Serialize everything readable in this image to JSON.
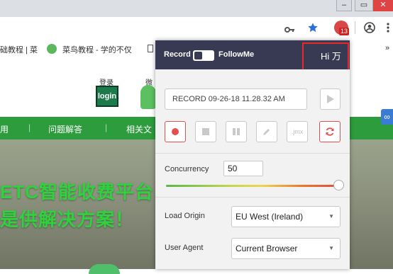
{
  "browser": {
    "window_controls": {
      "minimize": "–",
      "maximize": "▭",
      "close": "✕"
    },
    "toolbar": {
      "key_icon": "key-icon",
      "star_icon": "star-icon",
      "extension_badge": "13",
      "account_icon": "account-icon",
      "menu_icon": "more-vert-icon"
    },
    "bookmarks": {
      "item1": "础教程 | 菜",
      "item2": "菜鸟教程 - 学的不仅",
      "item3_icon": "page-icon",
      "overflow": "»"
    }
  },
  "site": {
    "login_label": "登录",
    "login_badge": "login",
    "wechat_label": "微",
    "nav": [
      "用",
      "问题解答",
      "相关文"
    ],
    "hero_line1": "ETC智能收费平台",
    "hero_line2": "是供解决方案！"
  },
  "popup": {
    "header": {
      "record_label": "Record",
      "followme_label": "FollowMe",
      "greeting": "Hi 万"
    },
    "record_name": "RECORD 09-26-18 11.28.32 AM",
    "tools": {
      "record": "record-icon",
      "stop": "stop-icon",
      "pause": "pause-icon",
      "edit": "pencil-icon",
      "jmx": ".jmx",
      "refresh": "refresh-icon"
    },
    "concurrency": {
      "label": "Concurrency",
      "value": "50",
      "slider_fraction": 1.0
    },
    "load_origin": {
      "label": "Load Origin",
      "value": "EU West (Ireland)"
    },
    "user_agent": {
      "label": "User Agent",
      "value": "Current Browser"
    },
    "colors": {
      "header_bg": "#383a53",
      "accent_red": "#e0514f",
      "highlight_box": "#e8292b"
    }
  }
}
